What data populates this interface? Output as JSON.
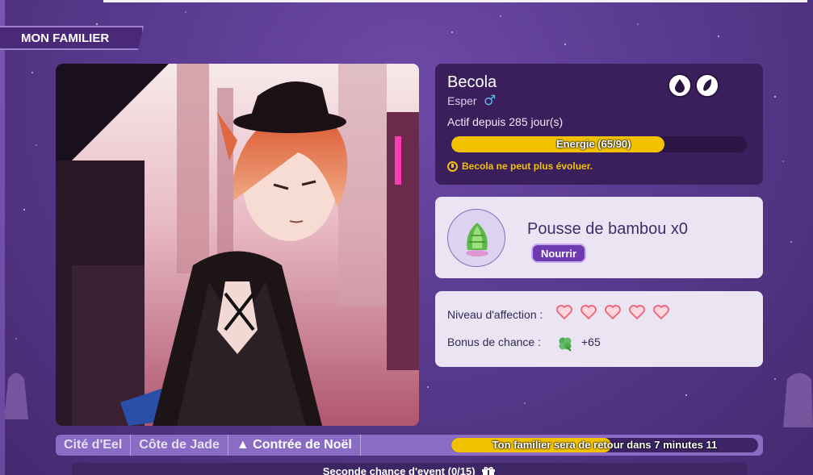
{
  "section": {
    "title": "MON FAMILIER"
  },
  "pet": {
    "name": "Becola",
    "race": "Esper",
    "gender_icon": "male-symbol-icon",
    "active_since": "Actif depuis 285 jour(s)",
    "energy_label": "Energie (65/90)",
    "energy_current": 65,
    "energy_max": 90,
    "evolve_warning": "Becola ne peut plus évoluer.",
    "status_icons": [
      "water-drop-icon",
      "feather-icon"
    ]
  },
  "food": {
    "name": "Pousse de bambou x0",
    "feed_label": "Nourrir",
    "icon": "bamboo-shoot-icon"
  },
  "stats": {
    "affection_label": "Niveau d'affection :",
    "affection_hearts": 5,
    "luck_label": "Bonus de chance :",
    "luck_value": "+65",
    "luck_icon": "clover-icon"
  },
  "nav": {
    "items": [
      {
        "label": "Cité d'Eel"
      },
      {
        "label": "Côte de Jade"
      },
      {
        "label": "▲ Contrée de Noël"
      }
    ],
    "return_label": "Ton familier sera de retour dans 7 minutes 11",
    "return_progress": 0.52
  },
  "event": {
    "label": "Seconde chance d'event (0/15)",
    "icon": "gift-icon"
  },
  "colors": {
    "accent_yellow": "#f2c200",
    "panel_dark": "#3b1f5c",
    "panel_light": "#ebe5f3",
    "button_purple": "#6d3ab0"
  }
}
